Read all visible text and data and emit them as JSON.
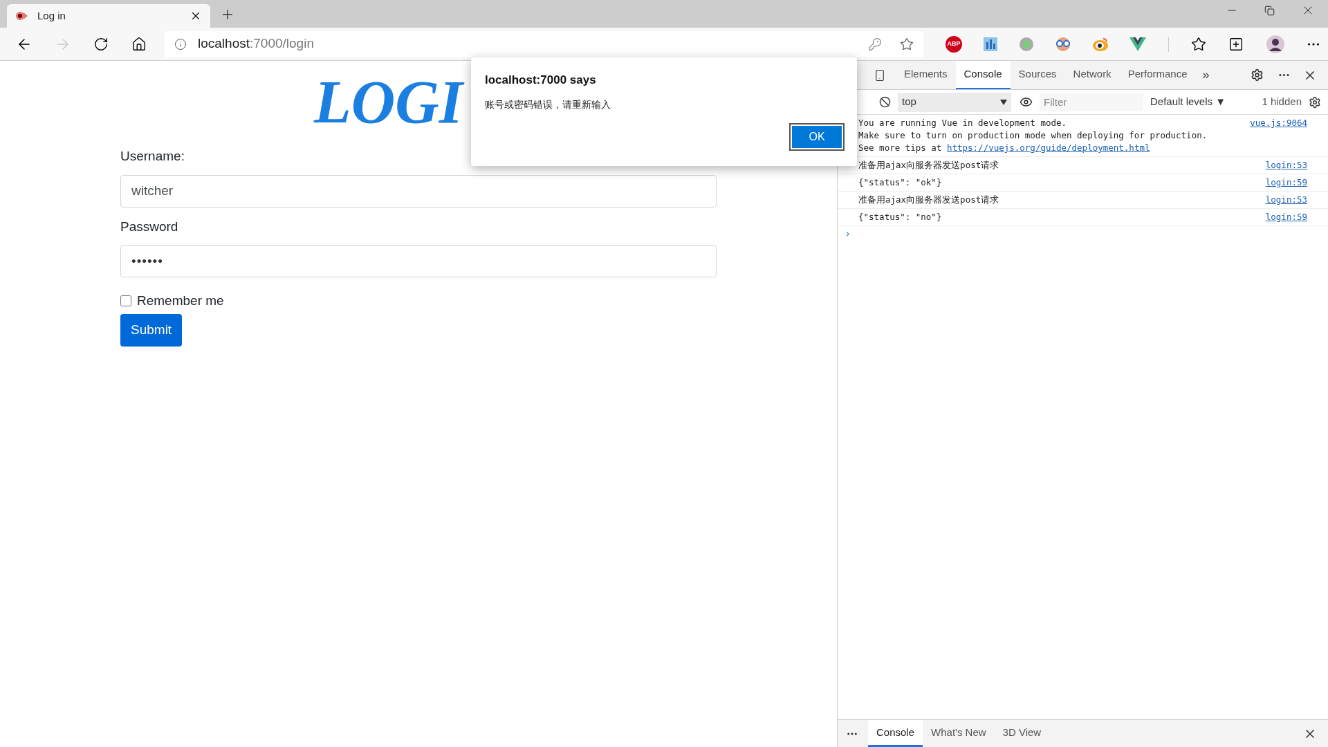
{
  "browser": {
    "tab": {
      "title": "Log in",
      "selected": true
    },
    "address": {
      "host": "localhost",
      "path": ":7000/login"
    },
    "extensions": [
      {
        "kind": "abp",
        "label": "ABP"
      },
      {
        "kind": "grid"
      },
      {
        "kind": "dot"
      },
      {
        "kind": "glasses"
      },
      {
        "kind": "eye"
      },
      {
        "kind": "vue"
      }
    ]
  },
  "page": {
    "heading": "LOGI",
    "fields": [
      {
        "label": "Username:",
        "value": "witcher",
        "kind": "text"
      },
      {
        "label": "Password",
        "value": "••••••",
        "kind": "password"
      }
    ],
    "remember": {
      "label": "Remember me",
      "checked": false
    },
    "submit": "Submit"
  },
  "dialog": {
    "title": "localhost:7000 says",
    "message": "账号或密码错误，请重新输入",
    "button": "OK"
  },
  "devtools": {
    "tabs": [
      {
        "label": "Elements",
        "selected": false
      },
      {
        "label": "Console",
        "selected": true
      },
      {
        "label": "Sources",
        "selected": false
      },
      {
        "label": "Network",
        "selected": false
      },
      {
        "label": "Performance",
        "selected": false
      }
    ],
    "more": "»",
    "context": "top",
    "filter_placeholder": "Filter",
    "levels": "Default levels ▼",
    "hidden": "1 hidden",
    "messages": [
      {
        "lines": [
          "You are running Vue in development mode.",
          "Make sure to turn on production mode when deploying for production."
        ],
        "tip": "See more tips at",
        "link": "https://vuejs.org/guide/deployment.html",
        "source": "vue.js:9064"
      },
      {
        "lines": [
          "准备用ajax向服务器发送post请求"
        ],
        "source": "login:53"
      },
      {
        "lines": [
          "{\"status\": \"ok\"}"
        ],
        "source": "login:59"
      },
      {
        "lines": [
          "准备用ajax向服务器发送post请求"
        ],
        "source": "login:53"
      },
      {
        "lines": [
          "{\"status\": \"no\"}"
        ],
        "source": "login:59"
      }
    ],
    "prompt": "›",
    "drawer_tabs": [
      {
        "label": "Console",
        "selected": true
      },
      {
        "label": "What's New",
        "selected": false
      },
      {
        "label": "3D View",
        "selected": false
      }
    ]
  }
}
